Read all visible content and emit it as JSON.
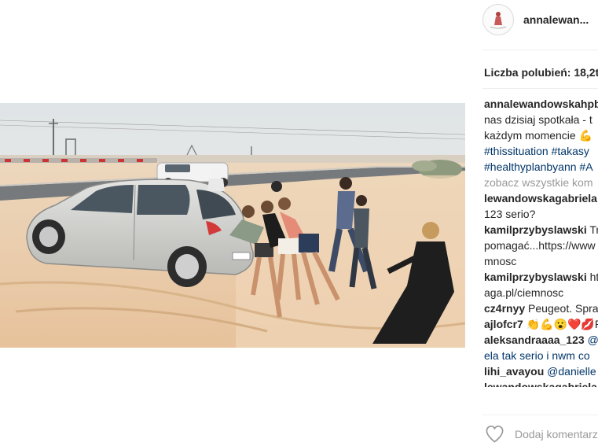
{
  "post": {
    "username": "annalewan...",
    "likes_text": "Liczba polubień: 18,2t"
  },
  "caption": {
    "username": "annalewandowskahpb",
    "lines": [
      "nas dzisiaj spotkała - t",
      "każdym momencie 💪"
    ],
    "hashtags": [
      "#thissituation #takasy",
      "#healthyplanbyann #A"
    ]
  },
  "view_all_label": "zobacz wszystkie kom",
  "comments": [
    {
      "user": "lewandowskagabriela",
      "lines": [
        "123 serio?"
      ]
    },
    {
      "user": "kamilprzybyslawski",
      "text": "Tr",
      "lines": [
        "pomagać...https://www",
        "mnosc"
      ]
    },
    {
      "user": "kamilprzybyslawski",
      "text": "ht",
      "lines": [
        "aga.pl/ciemnosc"
      ]
    },
    {
      "user": "cz4rnyy",
      "text": "Peugeot. Spra",
      "lines": []
    },
    {
      "user": "ajlofcr7",
      "text": "👏💪😮❤️💋PL",
      "lines": []
    },
    {
      "user": "aleksandraaaa_123",
      "text": "@",
      "lines": [
        "ela tak serio i nwm co"
      ]
    },
    {
      "user": "lihi_avayou",
      "text": "@danielle",
      "lines": []
    },
    {
      "user": "lewandowskagabriela",
      "text": "",
      "lines": []
    }
  ],
  "actions": {
    "like_icon": "heart-icon",
    "add_comment_placeholder": "Dodaj komentarz"
  },
  "colors": {
    "link": "#003569",
    "username": "#262626",
    "muted": "#999999",
    "sand": "#e8c9a6"
  }
}
